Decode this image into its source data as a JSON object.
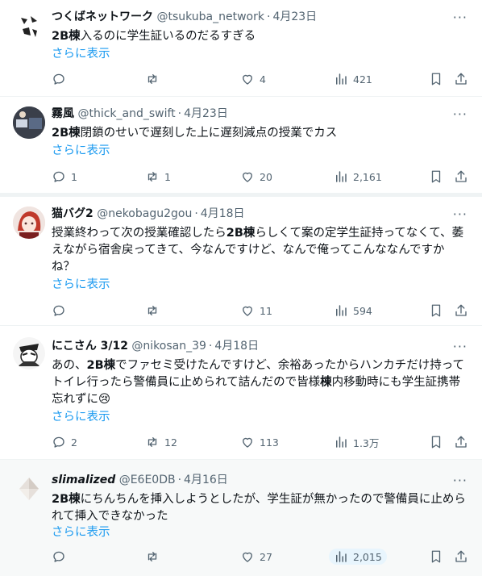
{
  "show_more_label": "さらに表示",
  "tweets": [
    {
      "name": "つくばネットワーク",
      "handle": "@tsukuba_network",
      "date": "4月23日",
      "text_bold": "2B棟",
      "text_rest": "入るのに学生証いるのだるすぎる",
      "replies": "",
      "retweets": "",
      "likes": "4",
      "views": "421"
    },
    {
      "name": "霧風",
      "handle": "@thick_and_swift",
      "date": "4月23日",
      "text_bold": "2B棟",
      "text_rest": "閉鎖のせいで遅刻した上に遅刻減点の授業でカス",
      "replies": "1",
      "retweets": "1",
      "likes": "20",
      "views": "2,161"
    },
    {
      "name": "猫バグ2",
      "handle": "@nekobagu2gou",
      "date": "4月18日",
      "text_pre": "授業終わって次の授業確認したら",
      "text_bold": "2B棟",
      "text_rest": "らしくて案の定学生証持ってなくて、萎えながら宿舎戻ってきて、今なんですけど、なんで俺ってこんななんですかね？",
      "replies": "",
      "retweets": "",
      "likes": "11",
      "views": "594"
    },
    {
      "name": "にこさん 3/12",
      "handle": "@nikosan_39",
      "date": "4月18日",
      "text_pre": "あの、",
      "text_bold": "2B棟",
      "text_mid": "でファセミ受けたんですけど、余裕あったからハンカチだけ持ってトイレ行ったら警備員に止められて詰んだので皆様",
      "text_bold2": "棟",
      "text_rest": "内移動時にも学生証携帯忘れずに😢",
      "replies": "2",
      "retweets": "12",
      "likes": "113",
      "views": "1.3万"
    },
    {
      "name": "slimalized",
      "handle": "@E6E0DB",
      "date": "4月16日",
      "text_bold": "2B棟",
      "text_rest": "にちんちんを挿入しようとしたが、学生証が無かったので警備員に止められて挿入できなかった",
      "replies": "",
      "retweets": "",
      "likes": "27",
      "views": "2,015"
    }
  ]
}
